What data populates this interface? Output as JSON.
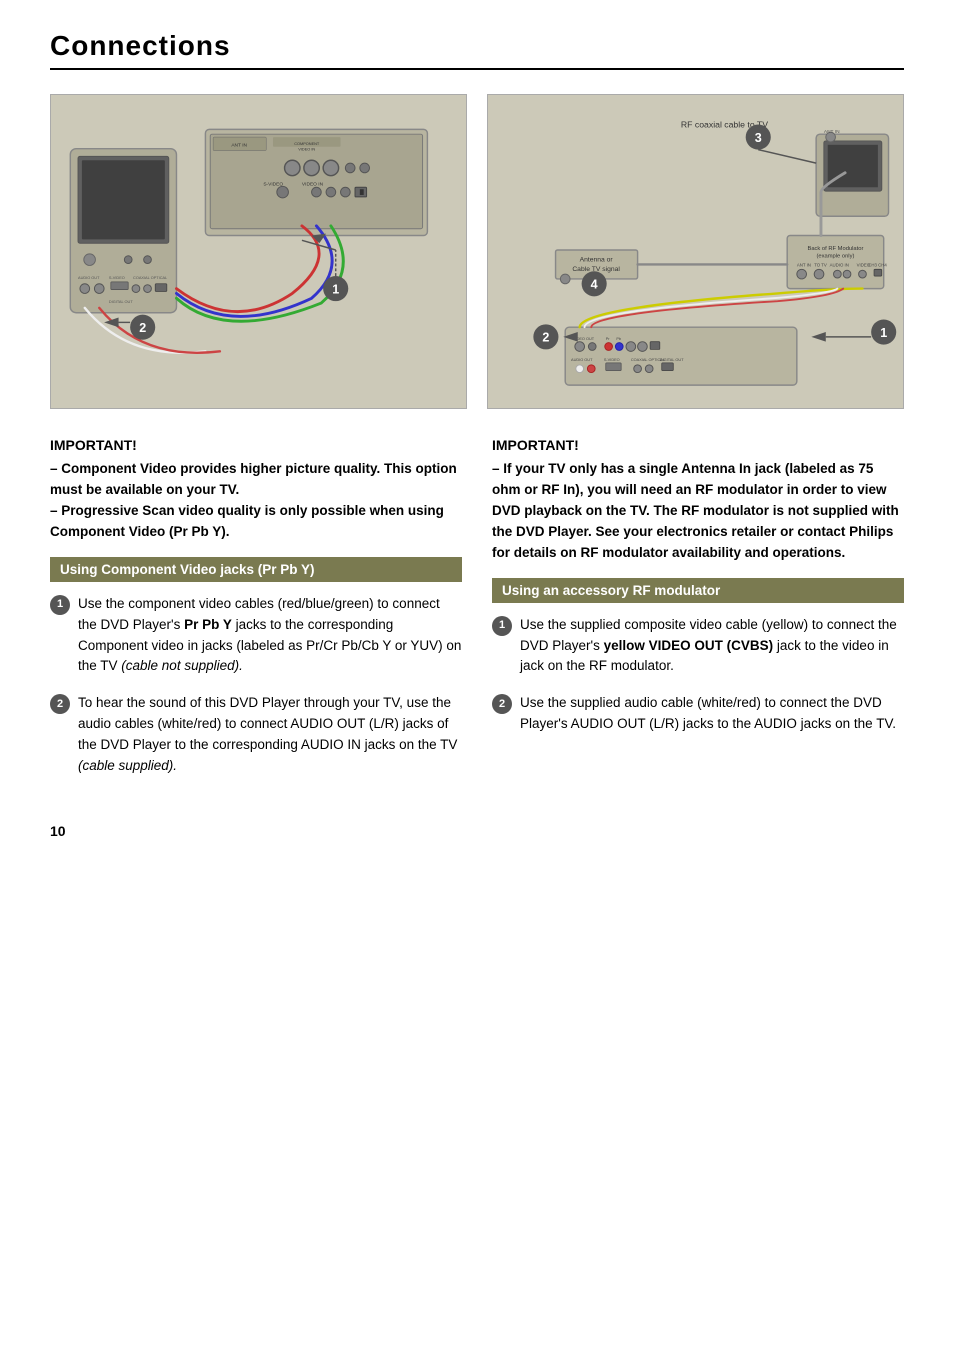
{
  "page": {
    "title": "Connections",
    "page_number": "10"
  },
  "left_section": {
    "important_label": "IMPORTANT!",
    "important_lines": [
      "– Component Video provides higher picture quality. This option must be available on your TV.",
      "– Progressive Scan video quality is only possible when using Component Video (Pr Pb Y)."
    ],
    "section_header": "Using Component Video jacks (Pr Pb Y)",
    "items": [
      {
        "num": "1",
        "text": "Use the component video cables (red/blue/green) to connect the DVD Player's Pr Pb Y jacks to the corresponding Component video in jacks (labeled as Pr/Cr Pb/Cb Y or YUV) on the TV (cable not supplied)."
      },
      {
        "num": "2",
        "text": "To hear the sound of this DVD Player through your TV, use the audio cables (white/red) to connect AUDIO OUT (L/R) jacks of the DVD Player to the corresponding AUDIO IN jacks on the TV (cable supplied)."
      }
    ]
  },
  "right_section": {
    "important_label": "IMPORTANT!",
    "important_text": "– If your TV only has a single Antenna In jack (labeled as 75 ohm or RF In), you will need an RF modulator in order to view DVD playback on the TV. The RF modulator is not supplied with the DVD Player. See your electronics retailer or contact Philips for details on RF modulator availability and operations.",
    "section_header": "Using an accessory RF modulator",
    "items": [
      {
        "num": "1",
        "text": "Use the supplied composite video cable (yellow) to connect the DVD Player's yellow VIDEO OUT (CVBS) jack to the video in jack on the RF modulator."
      },
      {
        "num": "2",
        "text": "Use the supplied audio cable (white/red) to connect the DVD Player's AUDIO OUT (L/R) jacks to the AUDIO jacks on the TV."
      }
    ]
  },
  "diagram_left": {
    "labels": [
      "ANT IN",
      "COMPONENT VIDEO IN",
      "S-VIDEO",
      "VIDEO IN",
      "AUDIO OUT",
      "S-VIDEO",
      "COAXIAL",
      "OPTICAL",
      "DIGITAL OUT"
    ],
    "circle_labels": [
      "1",
      "2"
    ]
  },
  "diagram_right": {
    "labels": [
      "RF coaxial cable to TV",
      "ANT IN",
      "Back of RF Modulator (example only)",
      "ANT IN",
      "TO TV",
      "AUDIO IN",
      "VIDEO",
      "CH3 CH4",
      "Antenna or Cable TV signal",
      "VIDEO OUT",
      "AUDIO OUT",
      "S-VIDEO",
      "COAXIAL",
      "OPTICAL",
      "DIGITAL OUT"
    ],
    "circle_labels": [
      "1",
      "2",
      "3",
      "4"
    ]
  }
}
